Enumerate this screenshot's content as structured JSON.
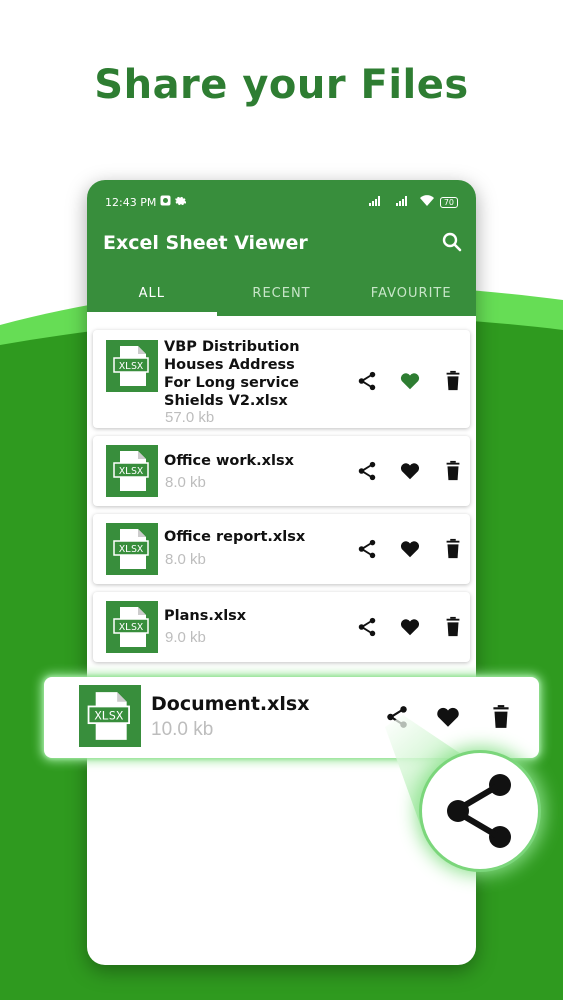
{
  "headline": "Share your Files",
  "status": {
    "time": "12:43 PM",
    "battery": "70"
  },
  "app": {
    "title": "Excel Sheet Viewer"
  },
  "tabs": [
    {
      "label": "ALL",
      "active": true
    },
    {
      "label": "RECENT",
      "active": false
    },
    {
      "label": "FAVOURITE",
      "active": false
    }
  ],
  "files": [
    {
      "name": "VBP Distribution Houses Address For Long service Shields V2.xlsx",
      "size": "57.0 kb",
      "favourite": true
    },
    {
      "name": "Office work.xlsx",
      "size": "8.0 kb",
      "favourite": false
    },
    {
      "name": "Office report.xlsx",
      "size": "8.0 kb",
      "favourite": false
    },
    {
      "name": "Plans.xlsx",
      "size": "9.0 kb",
      "favourite": false
    }
  ],
  "highlighted_file": {
    "name": "Document.xlsx",
    "size": "10.0 kb"
  },
  "file_icon_text": "XLSX",
  "colors": {
    "brand_green": "#388e3c",
    "headline_green": "#2e7d32",
    "glow": "#8fe28f",
    "favourite_active": "#2e7d32"
  },
  "icons": {
    "search": "search-icon",
    "share": "share-icon",
    "favourite": "heart-icon",
    "delete": "delete-icon",
    "file": "xlsx-file-icon"
  }
}
